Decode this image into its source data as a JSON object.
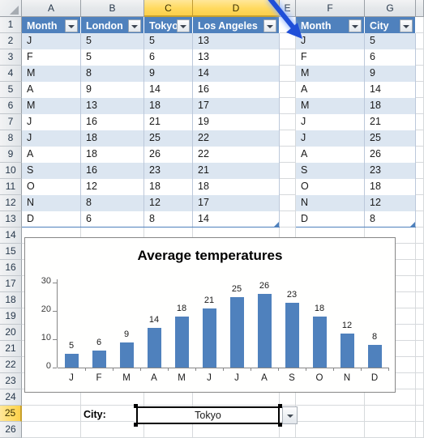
{
  "app": {
    "type": "spreadsheet"
  },
  "grid": {
    "column_headers": [
      {
        "label": "A",
        "selected": false
      },
      {
        "label": "B",
        "selected": false
      },
      {
        "label": "C",
        "selected": true
      },
      {
        "label": "D",
        "selected": true
      },
      {
        "label": "E",
        "selected": false
      },
      {
        "label": "F",
        "selected": false
      },
      {
        "label": "G",
        "selected": false
      }
    ],
    "row_headers": [
      {
        "label": "1",
        "selected": false
      },
      {
        "label": "2",
        "selected": false
      },
      {
        "label": "3",
        "selected": false
      },
      {
        "label": "4",
        "selected": false
      },
      {
        "label": "5",
        "selected": false
      },
      {
        "label": "6",
        "selected": false
      },
      {
        "label": "7",
        "selected": false
      },
      {
        "label": "8",
        "selected": false
      },
      {
        "label": "9",
        "selected": false
      },
      {
        "label": "10",
        "selected": false
      },
      {
        "label": "11",
        "selected": false
      },
      {
        "label": "12",
        "selected": false
      },
      {
        "label": "13",
        "selected": false
      },
      {
        "label": "14",
        "selected": false
      },
      {
        "label": "15",
        "selected": false
      },
      {
        "label": "16",
        "selected": false
      },
      {
        "label": "17",
        "selected": false
      },
      {
        "label": "18",
        "selected": false
      },
      {
        "label": "19",
        "selected": false
      },
      {
        "label": "20",
        "selected": false
      },
      {
        "label": "21",
        "selected": false
      },
      {
        "label": "22",
        "selected": false
      },
      {
        "label": "23",
        "selected": false
      },
      {
        "label": "24",
        "selected": false
      },
      {
        "label": "25",
        "selected": true
      },
      {
        "label": "26",
        "selected": false
      }
    ]
  },
  "source_table": {
    "name": "temperatures-table",
    "headers": [
      "Month",
      "London",
      "Tokyo",
      "Los Angeles"
    ],
    "rows": [
      [
        "J",
        "5",
        "5",
        "13"
      ],
      [
        "F",
        "5",
        "6",
        "13"
      ],
      [
        "M",
        "8",
        "9",
        "14"
      ],
      [
        "A",
        "9",
        "14",
        "16"
      ],
      [
        "M",
        "13",
        "18",
        "17"
      ],
      [
        "J",
        "16",
        "21",
        "19"
      ],
      [
        "J",
        "18",
        "25",
        "22"
      ],
      [
        "A",
        "18",
        "26",
        "22"
      ],
      [
        "S",
        "16",
        "23",
        "21"
      ],
      [
        "O",
        "12",
        "18",
        "18"
      ],
      [
        "N",
        "8",
        "12",
        "17"
      ],
      [
        "D",
        "6",
        "8",
        "14"
      ]
    ]
  },
  "result_table": {
    "name": "selected-city-table",
    "headers": [
      "Month",
      "City"
    ],
    "rows": [
      [
        "J",
        "5"
      ],
      [
        "F",
        "6"
      ],
      [
        "M",
        "9"
      ],
      [
        "A",
        "14"
      ],
      [
        "M",
        "18"
      ],
      [
        "J",
        "21"
      ],
      [
        "J",
        "25"
      ],
      [
        "A",
        "26"
      ],
      [
        "S",
        "23"
      ],
      [
        "O",
        "18"
      ],
      [
        "N",
        "12"
      ],
      [
        "D",
        "8"
      ]
    ]
  },
  "control": {
    "label": "City:",
    "selected_value": "Tokyo"
  },
  "chart_data": {
    "type": "bar",
    "title": "Average temperatures",
    "xlabel": "",
    "ylabel": "",
    "categories": [
      "J",
      "F",
      "M",
      "A",
      "M",
      "J",
      "J",
      "A",
      "S",
      "O",
      "N",
      "D"
    ],
    "values": [
      5,
      6,
      9,
      14,
      18,
      21,
      25,
      26,
      23,
      18,
      12,
      8
    ],
    "data_labels": [
      "5",
      "6",
      "9",
      "14",
      "18",
      "21",
      "25",
      "26",
      "23",
      "18",
      "12",
      "8"
    ],
    "yticks": [
      "0",
      "10",
      "20",
      "30"
    ],
    "ylim": [
      0,
      30
    ],
    "grid": false,
    "legend": false,
    "series_color": "#4F81BD"
  },
  "annotation": {
    "arrow_name": "blue-down-right-arrow",
    "color": "#1F4FD8"
  },
  "colors": {
    "table_header": "#4F81BD",
    "band_row": "#DCE6F1",
    "selected_header": "#FFD95E"
  }
}
